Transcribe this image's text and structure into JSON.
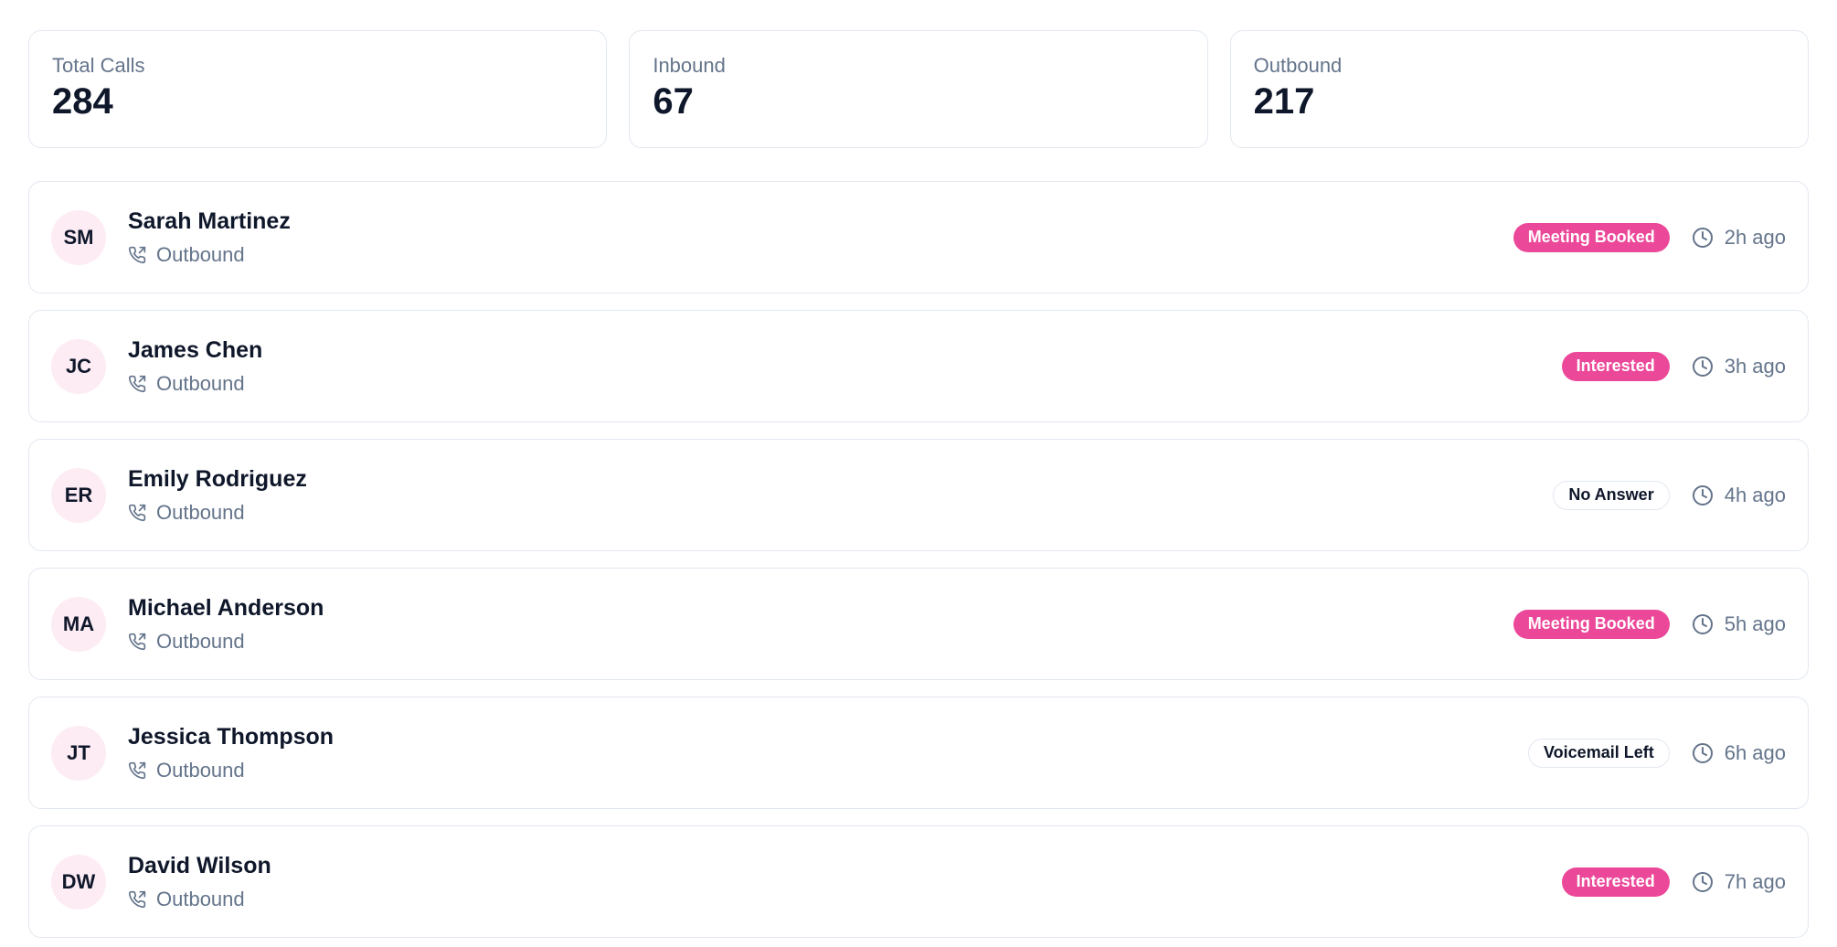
{
  "stats": [
    {
      "label": "Total Calls",
      "value": "284"
    },
    {
      "label": "Inbound",
      "value": "67"
    },
    {
      "label": "Outbound",
      "value": "217"
    }
  ],
  "calls": [
    {
      "initials": "SM",
      "name": "Sarah Martinez",
      "direction": "Outbound",
      "status": "Meeting Booked",
      "status_style": "pink",
      "time": "2h ago"
    },
    {
      "initials": "JC",
      "name": "James Chen",
      "direction": "Outbound",
      "status": "Interested",
      "status_style": "pink",
      "time": "3h ago"
    },
    {
      "initials": "ER",
      "name": "Emily Rodriguez",
      "direction": "Outbound",
      "status": "No Answer",
      "status_style": "outline",
      "time": "4h ago"
    },
    {
      "initials": "MA",
      "name": "Michael Anderson",
      "direction": "Outbound",
      "status": "Meeting Booked",
      "status_style": "pink",
      "time": "5h ago"
    },
    {
      "initials": "JT",
      "name": "Jessica Thompson",
      "direction": "Outbound",
      "status": "Voicemail Left",
      "status_style": "outline",
      "time": "6h ago"
    },
    {
      "initials": "DW",
      "name": "David Wilson",
      "direction": "Outbound",
      "status": "Interested",
      "status_style": "pink",
      "time": "7h ago"
    }
  ],
  "icons": {
    "direction": "phone-outgoing-icon",
    "time": "clock-icon"
  },
  "colors": {
    "accent": "#ec4899",
    "avatar_bg": "#fdecf4",
    "muted_text": "#64748b",
    "border": "#e2e8f0"
  }
}
